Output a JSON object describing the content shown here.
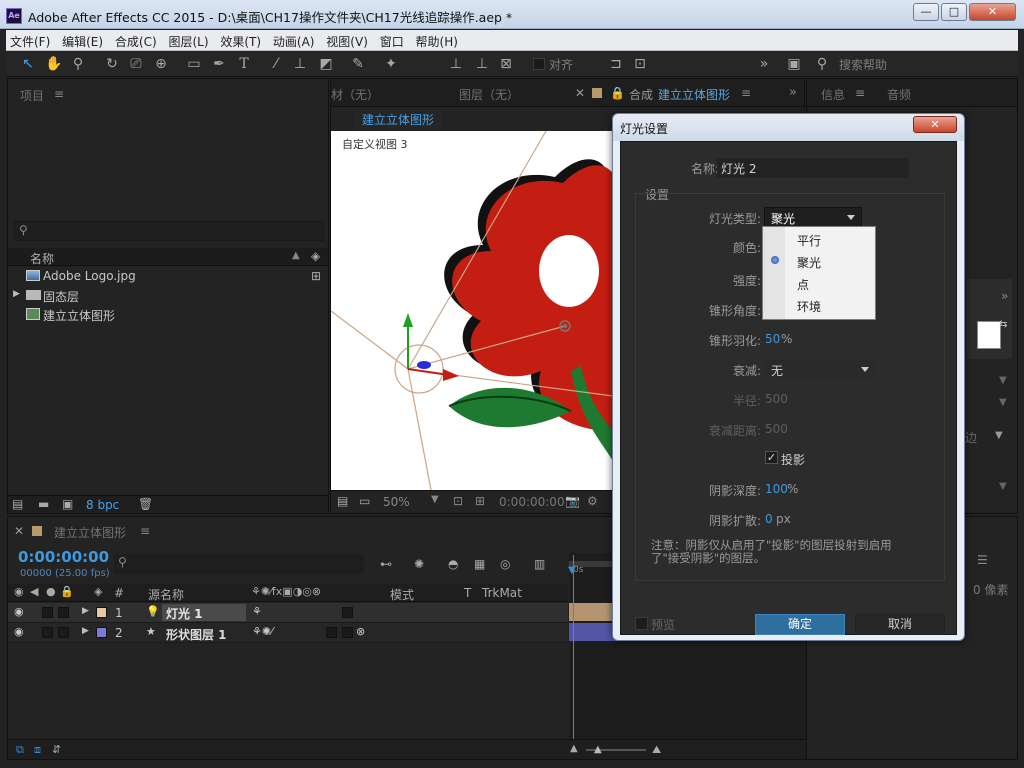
{
  "window": {
    "title": "Adobe After Effects CC 2015 - D:\\桌面\\CH17操作文件夹\\CH17光线追踪操作.aep *",
    "logo": "Ae",
    "minimize": "—",
    "maximize": "□",
    "close": "✕"
  },
  "menu": [
    "文件(F)",
    "编辑(E)",
    "合成(C)",
    "图层(L)",
    "效果(T)",
    "动画(A)",
    "视图(V)",
    "窗口",
    "帮助(H)"
  ],
  "toolbar": {
    "snap_label": "对齐",
    "search_placeholder": "搜索帮助"
  },
  "project": {
    "tab": "项目",
    "search_icon": "search-icon",
    "col_name": "名称",
    "items": [
      {
        "name": "Adobe Logo.jpg",
        "icon": "image-icon"
      },
      {
        "name": "固态层",
        "icon": "folder-icon"
      },
      {
        "name": "建立立体图形",
        "icon": "composition-icon"
      }
    ],
    "bpc": "8 bpc"
  },
  "viewer": {
    "tabs": [
      "材（无）",
      "图层（无）",
      "合成",
      "建立立体图形"
    ],
    "comp_label": "建立立体图形",
    "view_label": "自定义视图 3",
    "zoom": "50%",
    "time": "0:00:00:00"
  },
  "right_panel": {
    "tab_info": "信息",
    "tab_audio": "音频",
    "edge_label": "边",
    "pixel_label": "0 像素"
  },
  "timeline": {
    "tab": "建立立体图形",
    "timecode": "0:00:00:00",
    "fps": "00000 (25.00 fps)",
    "columns": {
      "num": "#",
      "source": "源名称",
      "mode": "模式",
      "t": "T",
      "trkmat": "TrkMat"
    },
    "layers": [
      {
        "num": "1",
        "name": "灯光 1",
        "color": "#e8c8a0"
      },
      {
        "num": "2",
        "name": "形状图层 1",
        "color": "#7b7ad6"
      }
    ],
    "ruler_label": "0s"
  },
  "dialog": {
    "title": "灯光设置",
    "close": "✕",
    "name_label": "名称:",
    "name_value": "灯光 2",
    "settings_label": "设置",
    "light_type_label": "灯光类型:",
    "light_type_value": "聚光",
    "light_type_options": [
      "平行",
      "聚光",
      "点",
      "环境"
    ],
    "color_label": "颜色:",
    "intensity_label": "强度:",
    "cone_angle_label": "锥形角度:",
    "cone_feather_label": "锥形羽化:",
    "cone_feather_value": "50",
    "percent": "%",
    "falloff_label": "衰减:",
    "falloff_value": "无",
    "radius_label": "半径:",
    "radius_value": "500",
    "falloff_distance_label": "衰减距离:",
    "falloff_distance_value": "500",
    "cast_shadows_label": "投影",
    "shadow_darkness_label": "阴影深度:",
    "shadow_darkness_value": "100",
    "shadow_diffusion_label": "阴影扩散:",
    "shadow_diffusion_value": "0",
    "px": "px",
    "note": "注意：阴影仅从启用了\"投影\"的图层投射到启用了\"接受阴影\"的图层。",
    "preview_label": "预览",
    "ok_label": "确定",
    "cancel_label": "取消"
  },
  "colors": {
    "accent": "#3d8ad0",
    "time_blue": "#3d9ae0",
    "ok_button": "#2f6f9e",
    "flower_red": "#c41e12",
    "stem_green": "#1e7a30"
  }
}
